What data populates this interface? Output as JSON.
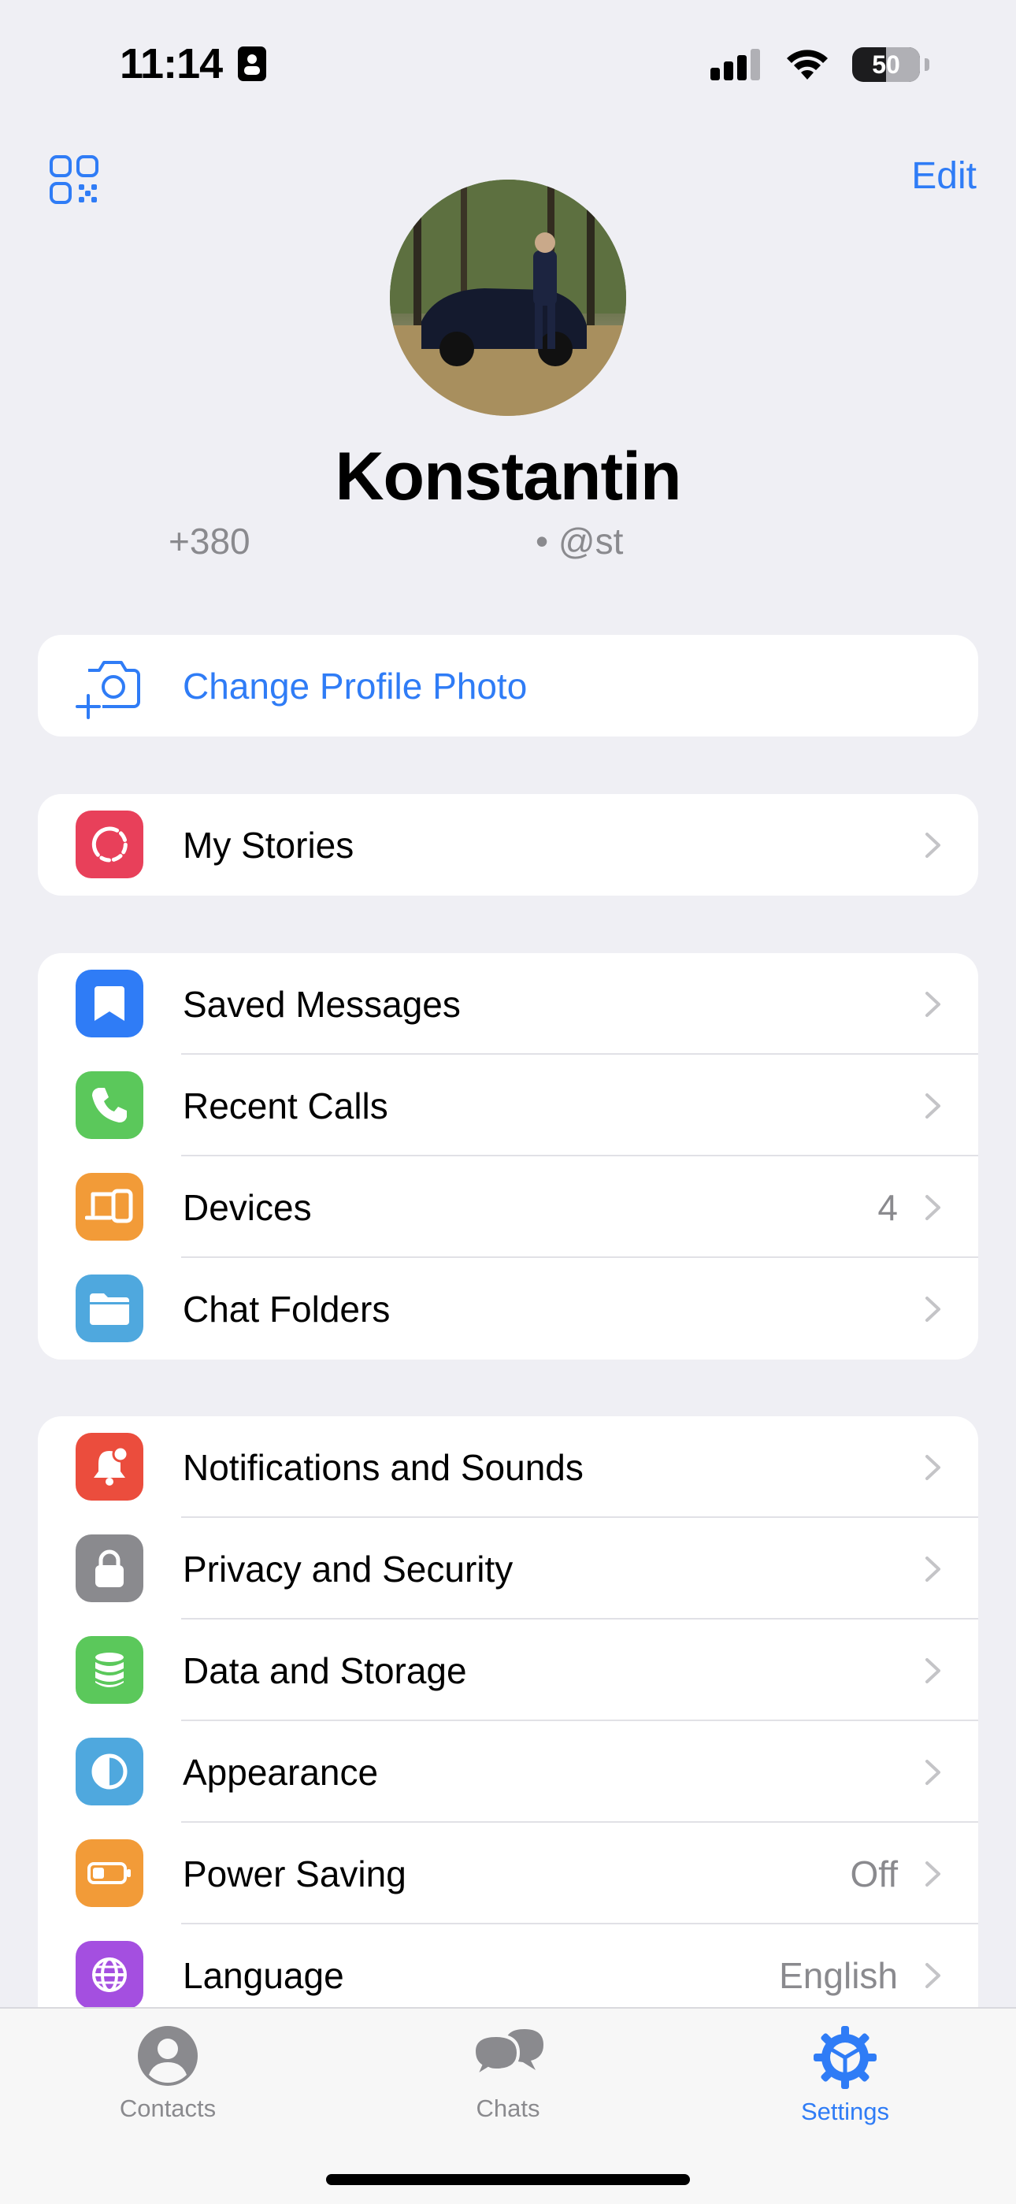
{
  "status_bar": {
    "time": "11:14",
    "battery": "50"
  },
  "header": {
    "edit": "Edit"
  },
  "profile": {
    "name": "Konstantin",
    "phone": "+380",
    "username": "• @st"
  },
  "change_photo": {
    "label": "Change Profile Photo"
  },
  "stories": {
    "label": "My Stories"
  },
  "group1": [
    {
      "label": "Saved Messages"
    },
    {
      "label": "Recent Calls"
    },
    {
      "label": "Devices",
      "value": "4"
    },
    {
      "label": "Chat Folders"
    }
  ],
  "group2": [
    {
      "label": "Notifications and Sounds"
    },
    {
      "label": "Privacy and Security"
    },
    {
      "label": "Data and Storage"
    },
    {
      "label": "Appearance"
    },
    {
      "label": "Power Saving",
      "value": "Off"
    },
    {
      "label": "Language",
      "value": "English"
    }
  ],
  "tabs": [
    {
      "label": "Contacts",
      "icon": "person-circle-icon"
    },
    {
      "label": "Chats",
      "icon": "chat-bubbles-icon"
    },
    {
      "label": "Settings",
      "icon": "gear-icon"
    }
  ],
  "colors": {
    "accent": "#2F7CF6",
    "stories": "#E8405A",
    "saved": "#2F7CF6",
    "calls": "#5BC85B",
    "devices": "#F29B38",
    "folders": "#4FA8DE",
    "notifications": "#EB4D3D",
    "privacy": "#8A8A8E",
    "data": "#5BC85B",
    "appearance": "#4FA8DE",
    "power": "#F29B38",
    "language": "#A44FE0"
  }
}
